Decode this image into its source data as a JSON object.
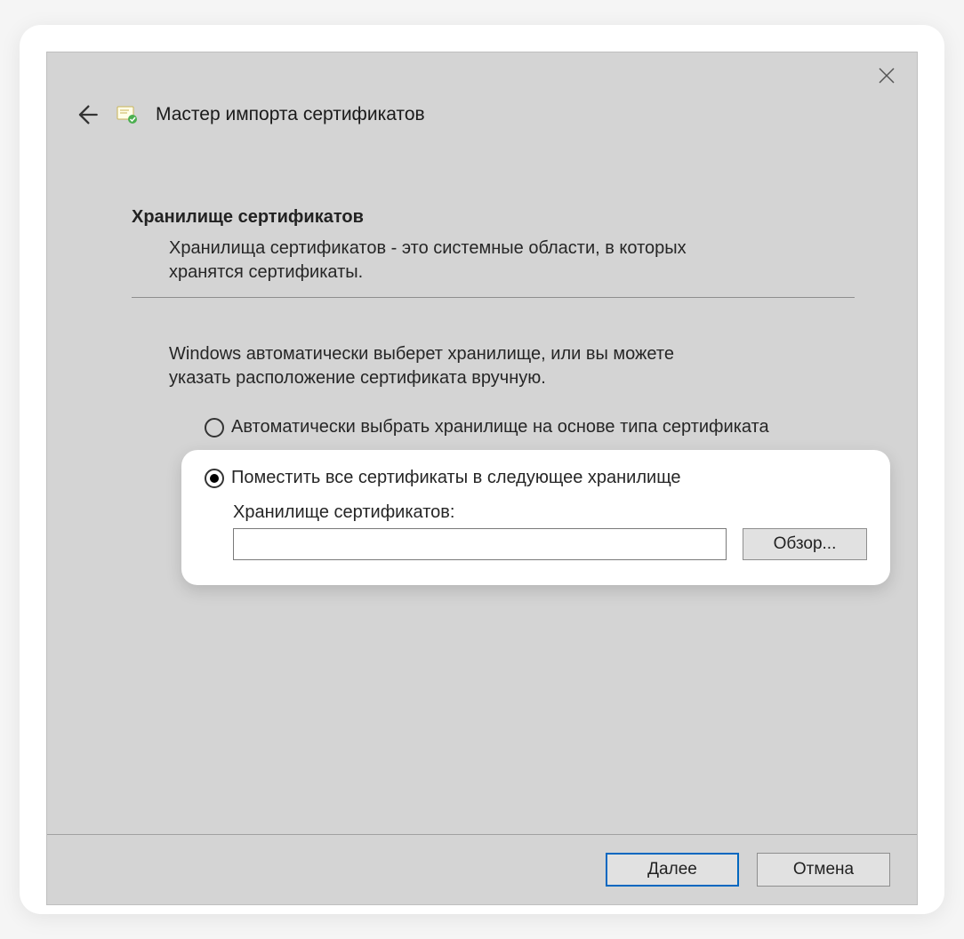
{
  "header": {
    "title": "Мастер импорта сертификатов"
  },
  "section": {
    "heading": "Хранилище сертификатов",
    "description": "Хранилища сертификатов - это системные области, в которых хранятся сертификаты."
  },
  "instruction": "Windows автоматически выберет хранилище, или вы можете указать расположение сертификата вручную.",
  "options": {
    "auto": "Автоматически выбрать хранилище на основе типа сертификата",
    "manual": "Поместить все сертификаты в следующее хранилище",
    "selected": "manual"
  },
  "store": {
    "label": "Хранилище сертификатов:",
    "value": "",
    "browse": "Обзор..."
  },
  "footer": {
    "next": "Далее",
    "cancel": "Отмена"
  }
}
